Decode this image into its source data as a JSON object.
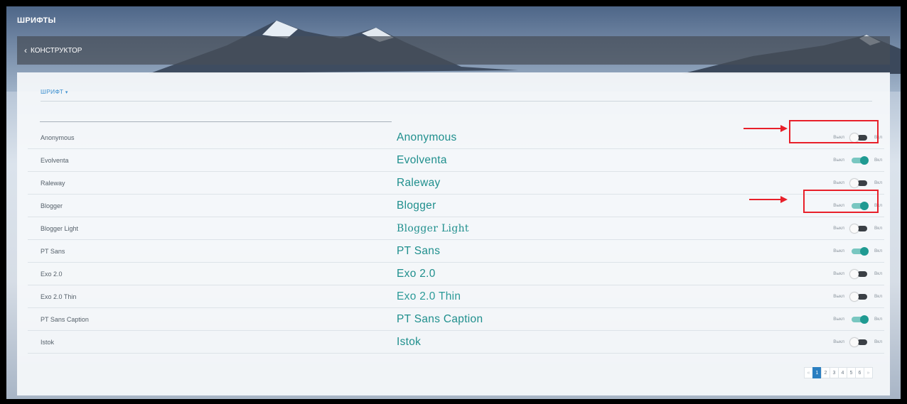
{
  "header": {
    "title": "ШРИФТЫ",
    "breadcrumb_label": "КОНСТРУКТОР"
  },
  "section": {
    "label": "ШРИФТ"
  },
  "search": {
    "value": ""
  },
  "toggle_labels": {
    "off": "Выкл",
    "on": "Вкл"
  },
  "fonts": [
    {
      "name": "Anonymous",
      "preview": "Anonymous",
      "enabled": false
    },
    {
      "name": "Evolventa",
      "preview": "Evolventa",
      "enabled": true
    },
    {
      "name": "Raleway",
      "preview": "Raleway",
      "enabled": false
    },
    {
      "name": "Blogger",
      "preview": "Blogger",
      "enabled": true
    },
    {
      "name": "Blogger Light",
      "preview": "Blogger Light",
      "enabled": false
    },
    {
      "name": "PT Sans",
      "preview": "PT Sans",
      "enabled": true
    },
    {
      "name": "Exo 2.0",
      "preview": "Exo 2.0",
      "enabled": false
    },
    {
      "name": "Exo 2.0 Thin",
      "preview": "Exo 2.0 Thin",
      "enabled": false
    },
    {
      "name": "PT Sans Caption",
      "preview": "PT Sans Caption",
      "enabled": true
    },
    {
      "name": "Istok",
      "preview": "Istok",
      "enabled": false
    }
  ],
  "pagination": {
    "prev": "«",
    "pages": [
      "1",
      "2",
      "3",
      "4",
      "5",
      "6"
    ],
    "current": "1",
    "next": "»"
  },
  "colors": {
    "accent": "#1f9a92",
    "link": "#3b8fcf",
    "annotation": "#e8202a"
  }
}
